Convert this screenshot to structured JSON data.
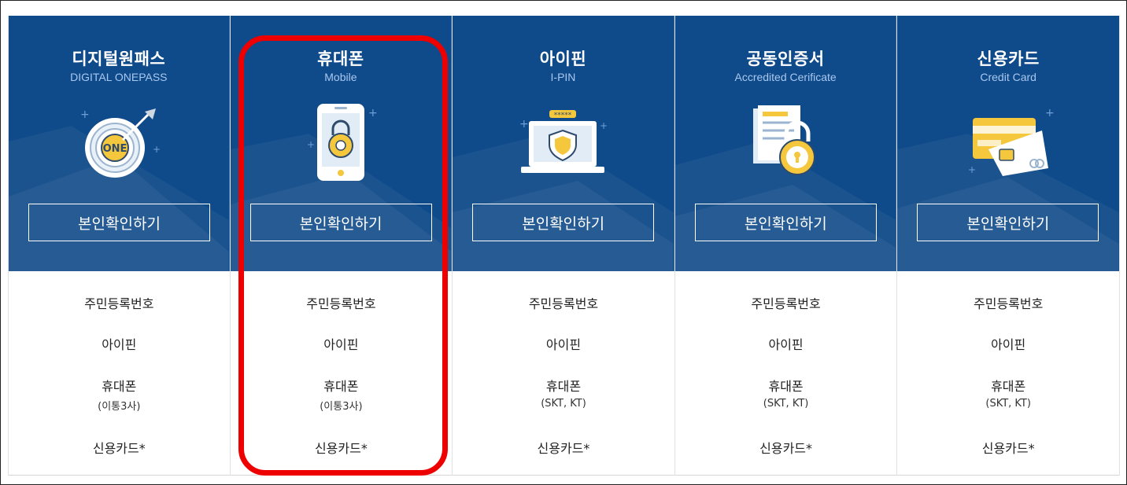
{
  "methods": [
    {
      "title": "디지털원패스",
      "subtitle": "DIGITAL ONEPASS",
      "icon": "target-one-icon",
      "button": "본인확인하기",
      "items": [
        "주민등록번호",
        "아이핀",
        "휴대폰",
        "(이통3사)",
        "신용카드*"
      ]
    },
    {
      "title": "휴대폰",
      "subtitle": "Mobile",
      "icon": "phone-lock-icon",
      "button": "본인확인하기",
      "items": [
        "주민등록번호",
        "아이핀",
        "휴대폰",
        "(이통3사)",
        "신용카드*"
      ]
    },
    {
      "title": "아이핀",
      "subtitle": "I-PIN",
      "icon": "laptop-shield-icon",
      "button": "본인확인하기",
      "items": [
        "주민등록번호",
        "아이핀",
        "휴대폰",
        "(SKT, KT)",
        "신용카드*"
      ]
    },
    {
      "title": "공동인증서",
      "subtitle": "Accredited Cerificate",
      "icon": "certificate-lock-icon",
      "button": "본인확인하기",
      "items": [
        "주민등록번호",
        "아이핀",
        "휴대폰",
        "(SKT, KT)",
        "신용카드*"
      ]
    },
    {
      "title": "신용카드",
      "subtitle": "Credit Card",
      "icon": "credit-card-icon",
      "button": "본인확인하기",
      "items": [
        "주민등록번호",
        "아이핀",
        "휴대폰",
        "(SKT, KT)",
        "신용카드*"
      ]
    }
  ],
  "colors": {
    "panel": "#0f4a8a",
    "accent": "#f5c73d",
    "highlight": "#ee0000"
  },
  "icons": {
    "one_label": "ONE",
    "pin_mask": "*****"
  }
}
